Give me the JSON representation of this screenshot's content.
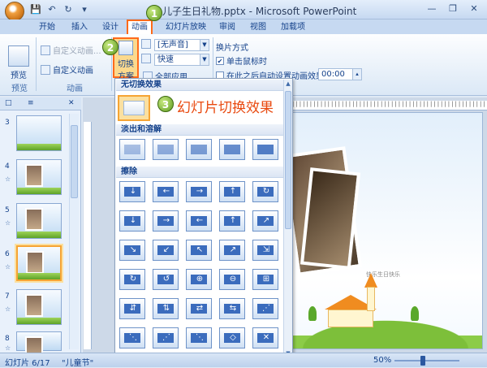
{
  "window": {
    "title": "儿子生日礼物.pptx - Microsoft PowerPoint",
    "controls": [
      "—",
      "❐",
      "✕"
    ]
  },
  "qat": [
    "💾",
    "↶",
    "↻",
    "▾"
  ],
  "tabs": [
    "开始",
    "插入",
    "设计",
    "动画",
    "幻灯片放映",
    "审阅",
    "视图",
    "加载项"
  ],
  "active_tab": "动画",
  "ribbon": {
    "preview": {
      "label": "预览",
      "group": "预览"
    },
    "custom_anim": {
      "top": "自定义动画...",
      "bottom": "自定义动画",
      "group": "动画"
    },
    "scheme": {
      "line1": "切换",
      "line2": "方案"
    },
    "sound": "[无声音]",
    "speed": "快速",
    "apply_all": "全部应用",
    "advance": {
      "title": "换片方式",
      "on_click": "单击鼠标时",
      "after": "在此之后自动设置动画效果:",
      "time": "00:00"
    }
  },
  "callouts": {
    "c1": "1",
    "c2": "2",
    "c3": "3",
    "c3_text": "幻灯片切换效果"
  },
  "gallery": {
    "section_none": "无切换效果",
    "section_fade": "淡出和溶解",
    "section_wipe": "擦除",
    "fade_items": 5,
    "wipe_rows": 6
  },
  "left_panel": {
    "tab_outline": "□",
    "tab_slides": "≡",
    "close": "✕",
    "slides": [
      {
        "num": "3",
        "selected": false
      },
      {
        "num": "4",
        "selected": false
      },
      {
        "num": "5",
        "selected": false
      },
      {
        "num": "6",
        "selected": true
      },
      {
        "num": "7",
        "selected": false
      },
      {
        "num": "8",
        "selected": false
      }
    ],
    "star": "☆"
  },
  "slide": {
    "caption": "快乐生日快乐"
  },
  "status": {
    "slide_info": "幻灯片 6/17",
    "theme": "\"儿童节\"",
    "zoom": "50%"
  },
  "colors": {
    "accent": "#ff6a1a",
    "ribbon_bg": "#dbe8f6",
    "text": "#15428b",
    "callout_text": "#e94a10"
  }
}
